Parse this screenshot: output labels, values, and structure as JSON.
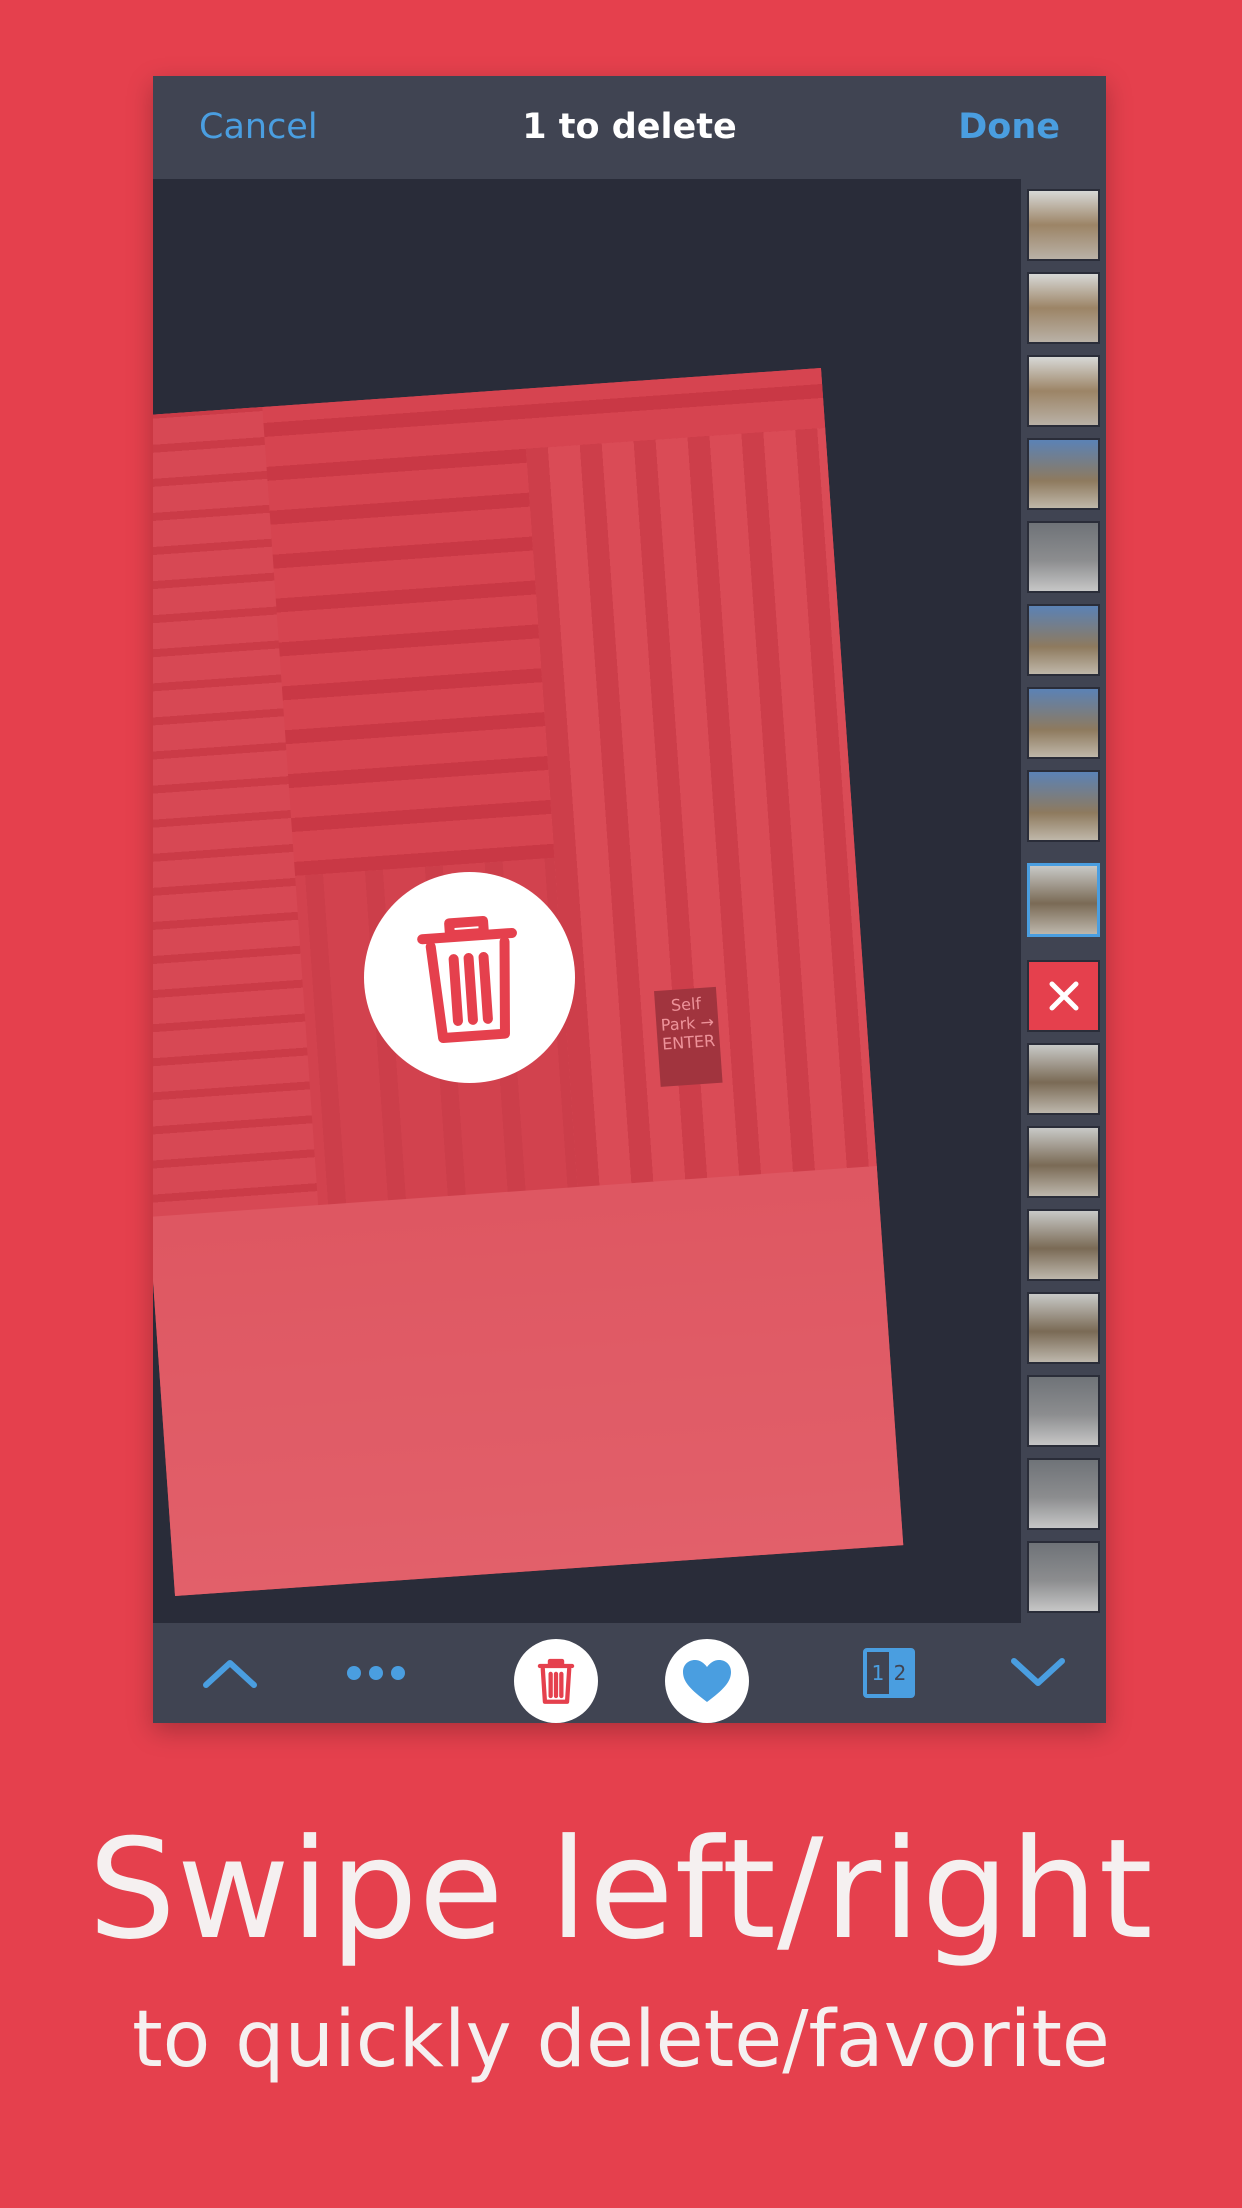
{
  "navbar": {
    "cancel_label": "Cancel",
    "title": "1 to delete",
    "done_label": "Done"
  },
  "photo": {
    "sign_text": "Self Park → ENTER",
    "status": "marked-for-delete"
  },
  "thumbnails": [
    {
      "kind": "a"
    },
    {
      "kind": "a"
    },
    {
      "kind": "a"
    },
    {
      "kind": "b"
    },
    {
      "kind": "d"
    },
    {
      "kind": "b"
    },
    {
      "kind": "b"
    },
    {
      "kind": "b"
    },
    {
      "kind": "c",
      "selected": true
    },
    {
      "kind": "deleted"
    },
    {
      "kind": "c"
    },
    {
      "kind": "c"
    },
    {
      "kind": "c"
    },
    {
      "kind": "c"
    },
    {
      "kind": "d"
    },
    {
      "kind": "d"
    },
    {
      "kind": "d"
    }
  ],
  "toolbar": {
    "compare_left": "1",
    "compare_right": "2"
  },
  "marketing": {
    "headline": "Swipe left/right",
    "subline": "to quickly delete/favorite"
  },
  "colors": {
    "background": "#e5404d",
    "accent": "#4a9ee0",
    "bar": "#404452",
    "viewer": "#292c39"
  }
}
